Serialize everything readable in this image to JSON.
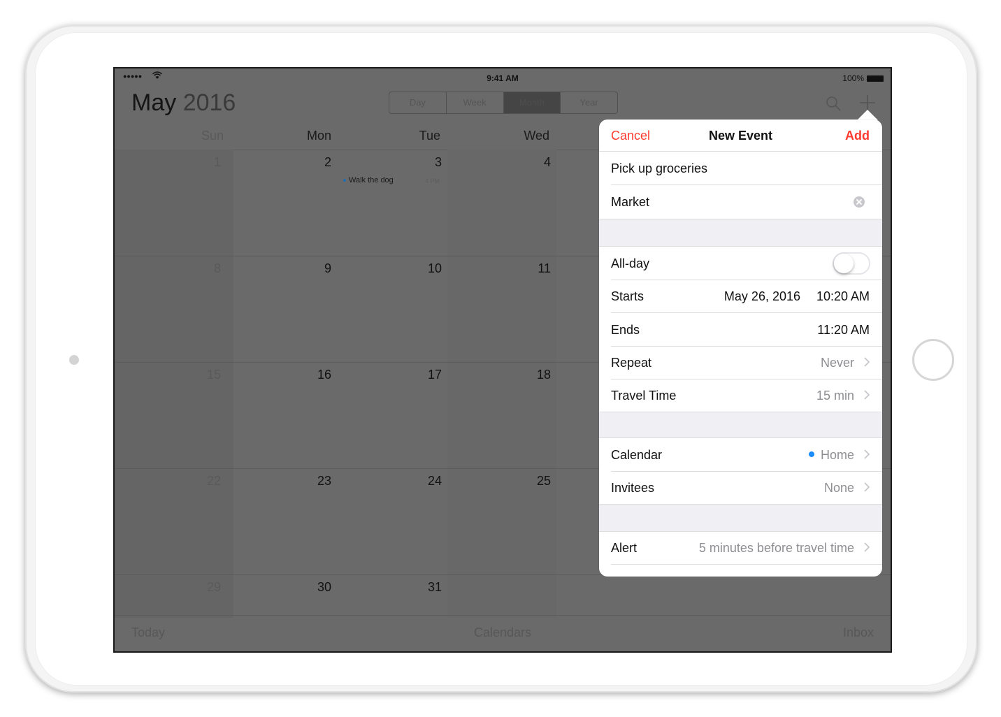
{
  "status_bar": {
    "signal": "●●●●●",
    "time": "9:41 AM",
    "battery": "100%"
  },
  "calendar": {
    "month": "May",
    "year": "2016",
    "views": [
      "Day",
      "Week",
      "Month",
      "Year"
    ],
    "active_view": "Month",
    "weekdays": [
      "Sun",
      "Mon",
      "Tue",
      "Wed"
    ],
    "weeks": [
      [
        "1",
        "2",
        "3",
        "4"
      ],
      [
        "8",
        "9",
        "10",
        "11"
      ],
      [
        "15",
        "16",
        "17",
        "18"
      ],
      [
        "22",
        "23",
        "24",
        "25"
      ],
      [
        "29",
        "30",
        "31",
        ""
      ]
    ],
    "event": {
      "title": "Walk the dog",
      "time": "4 PM"
    }
  },
  "tabbar": {
    "today": "Today",
    "calendars": "Calendars",
    "inbox": "Inbox"
  },
  "new_event": {
    "cancel": "Cancel",
    "title": "New Event",
    "add": "Add",
    "event_title": "Pick up groceries",
    "location": "Market",
    "allday_label": "All-day",
    "allday_on": false,
    "starts_label": "Starts",
    "starts_date": "May 26, 2016",
    "starts_time": "10:20 AM",
    "ends_label": "Ends",
    "ends_time": "11:20 AM",
    "repeat_label": "Repeat",
    "repeat_value": "Never",
    "travel_label": "Travel Time",
    "travel_value": "15 min",
    "calendar_label": "Calendar",
    "calendar_value": "Home",
    "calendar_color": "#1a8cff",
    "invitees_label": "Invitees",
    "invitees_value": "None",
    "alert_label": "Alert",
    "alert_value": "5 minutes before travel time"
  },
  "colors": {
    "accent": "#ff3b30"
  }
}
